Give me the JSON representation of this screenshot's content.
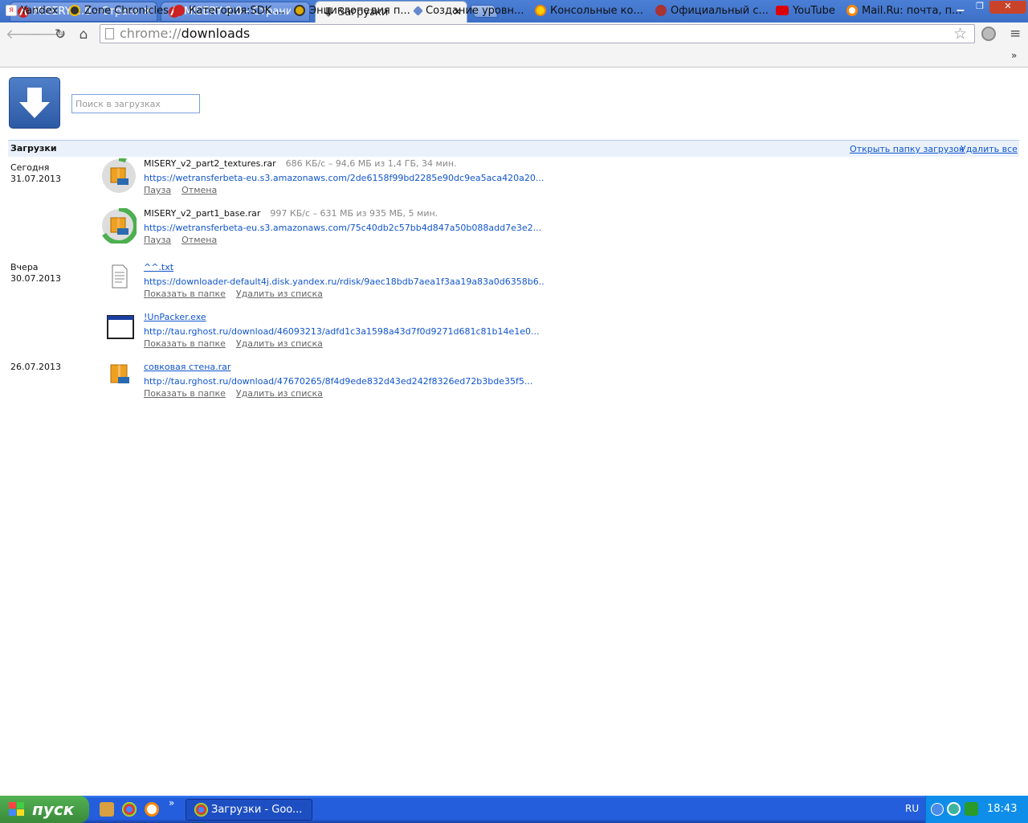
{
  "window": {
    "tabs": [
      {
        "label": "MISERY 2.0 - Страниц",
        "active": false
      },
      {
        "label": "MISERY 2.0 - Страниц",
        "active": false
      },
      {
        "label": "Загрузки",
        "active": true
      }
    ],
    "controls": {
      "minimize": "▁",
      "maximize": "❐",
      "close": "✕"
    }
  },
  "toolbar": {
    "address_scheme": "chrome://",
    "address_path": "downloads"
  },
  "bookmarks": [
    {
      "label": "Yandex",
      "icon": "yandex-icon",
      "color": "#e33"
    },
    {
      "label": "Zone Chronicles",
      "icon": "radiation-icon",
      "color": "#333"
    },
    {
      "label": "Категория:SDK ...",
      "icon": "category-icon",
      "color": "#c22"
    },
    {
      "label": "Энциклопедия п...",
      "icon": "radiation-icon",
      "color": "#da0"
    },
    {
      "label": "Создание уровн...",
      "icon": "diamond-icon",
      "color": "#68c"
    },
    {
      "label": "Консольные ко...",
      "icon": "radiation-icon",
      "color": "#fc0"
    },
    {
      "label": "Официальный с...",
      "icon": "misery-icon",
      "color": "#a33"
    },
    {
      "label": "YouTube",
      "icon": "youtube-icon",
      "color": "#d00"
    },
    {
      "label": "Mail.Ru: почта, п...",
      "icon": "mailru-icon",
      "color": "#f80"
    }
  ],
  "page": {
    "search_placeholder": "Поиск в загрузках",
    "header_title": "Загрузки",
    "open_folder": "Открыть папку загрузок",
    "clear_all": "Удалить все"
  },
  "groups": [
    {
      "date_title": "Сегодня",
      "date": "31.07.2013",
      "items": [
        {
          "name": "MISERY_v2_part2_textures.rar",
          "status": "686 КБ/с – 94,6 МБ из 1,4 ГБ, 34 мин.",
          "url": "https://wetransferbeta-eu.s3.amazonaws.com/2de6158f99bd2285e90dc9ea5aca420a20...",
          "actions": [
            "Пауза",
            "Отмена"
          ],
          "progress": 0.07,
          "icon": "rar-archive-icon"
        },
        {
          "name": "MISERY_v2_part1_base.rar",
          "status": "997 КБ/с – 631 МБ из 935 МБ, 5 мин.",
          "url": "https://wetransferbeta-eu.s3.amazonaws.com/75c40db2c57bb4d847a50b088add7e3e2...",
          "actions": [
            "Пауза",
            "Отмена"
          ],
          "progress": 0.67,
          "icon": "rar-archive-icon"
        }
      ]
    },
    {
      "date_title": "Вчера",
      "date": "30.07.2013",
      "items": [
        {
          "name": "^^.txt",
          "url": "https://downloader-default4j.disk.yandex.ru/rdisk/9aec18bdb7aea1f3aa19a83a0d6358b6...",
          "actions": [
            "Показать в папке",
            "Удалить из списка"
          ],
          "icon": "text-file-icon"
        },
        {
          "name": "!UnPacker.exe",
          "url": "http://tau.rghost.ru/download/46093213/adfd1c3a1598a43d7f0d9271d681c81b14e1e0...",
          "actions": [
            "Показать в папке",
            "Удалить из списка"
          ],
          "icon": "exe-file-icon"
        }
      ]
    },
    {
      "date_title": "",
      "date": "26.07.2013",
      "items": [
        {
          "name": "совковая стена.rar",
          "url": "http://tau.rghost.ru/download/47670265/8f4d9ede832d43ed242f8326ed72b3bde35f5...",
          "actions": [
            "Показать в папке",
            "Удалить из списка"
          ],
          "icon": "rar-archive-icon"
        }
      ]
    }
  ],
  "taskbar": {
    "start_label": "пуск",
    "task_label": "Загрузки - Goo...",
    "language": "RU",
    "clock": "18:43",
    "quicklaunch_more": "»"
  }
}
